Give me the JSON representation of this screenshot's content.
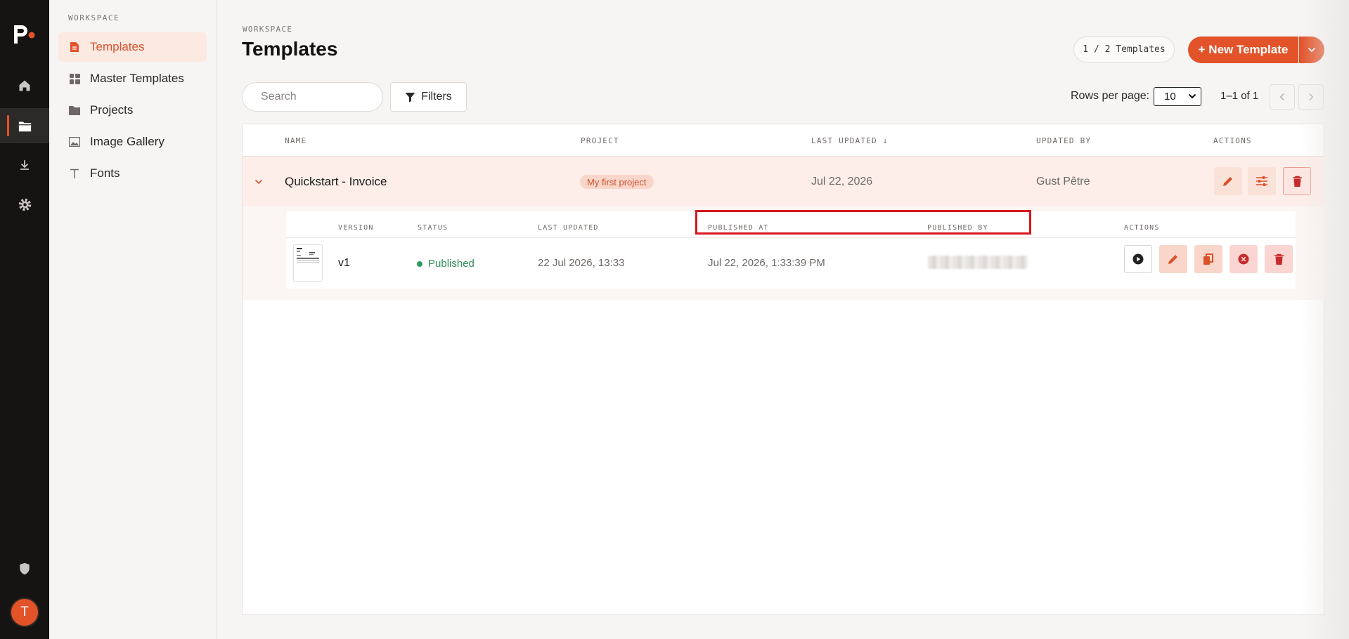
{
  "sidebar": {
    "section_label": "WORKSPACE",
    "items": [
      {
        "label": "Templates",
        "icon": "document-icon"
      },
      {
        "label": "Master Templates",
        "icon": "grid-icon"
      },
      {
        "label": "Projects",
        "icon": "folder-icon"
      },
      {
        "label": "Image Gallery",
        "icon": "image-icon"
      },
      {
        "label": "Fonts",
        "icon": "font-icon"
      }
    ]
  },
  "rail": {
    "avatar_initial": "T",
    "nav_icons": [
      "home-icon",
      "folder-icon",
      "download-icon",
      "gear-icon",
      "shield-icon"
    ]
  },
  "header": {
    "breadcrumb": "WORKSPACE",
    "title": "Templates",
    "count": "1 / 2 Templates",
    "new_button": "+ New Template"
  },
  "toolbar": {
    "search_placeholder": "Search",
    "filters_label": "Filters",
    "rows_per_page_label": "Rows per page:",
    "rows_per_page_value": "10",
    "range": "1–1 of 1"
  },
  "table": {
    "columns": [
      "NAME",
      "PROJECT",
      "LAST UPDATED ↓",
      "UPDATED BY",
      "ACTIONS"
    ],
    "rows": [
      {
        "name": "Quickstart - Invoice",
        "project": "My first project",
        "last_updated": "Jul 22, 2026",
        "updated_by": "Gust Pêtre"
      }
    ],
    "versions": {
      "columns": [
        "VERSION",
        "STATUS",
        "LAST UPDATED",
        "PUBLISHED AT",
        "PUBLISHED BY",
        "ACTIONS"
      ],
      "rows": [
        {
          "version": "v1",
          "status": "Published",
          "last_updated": "22 Jul 2026, 13:33",
          "published_at": "Jul 22, 2026, 1:33:39 PM"
        }
      ]
    }
  },
  "colors": {
    "accent": "#e2532a",
    "rail_bg": "#161413",
    "row_highlight": "#fdeeea",
    "published_green": "#2e8f57",
    "annotation_red": "#d7161e"
  }
}
